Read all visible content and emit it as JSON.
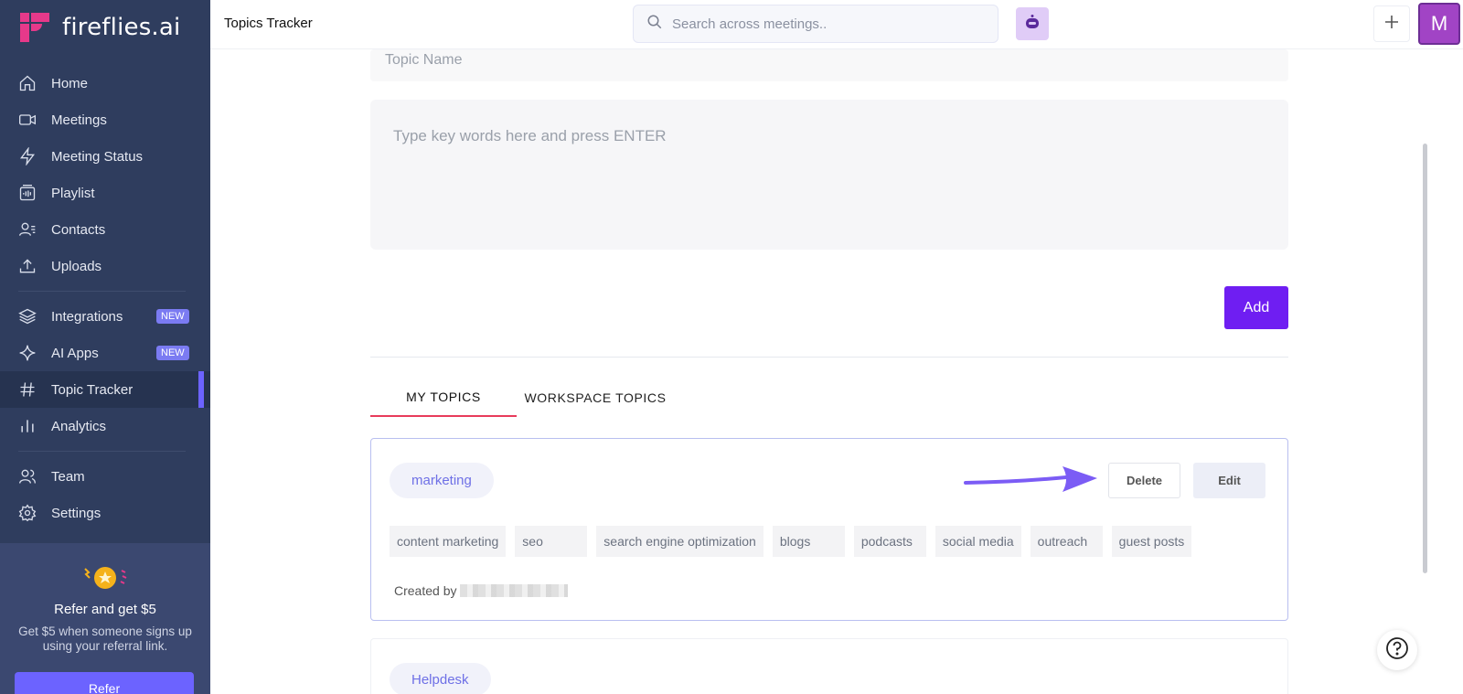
{
  "brand": {
    "name": "fireflies.ai"
  },
  "sidebar": {
    "items": [
      {
        "label": "Home",
        "icon": "home-icon"
      },
      {
        "label": "Meetings",
        "icon": "video-icon"
      },
      {
        "label": "Meeting Status",
        "icon": "bolt-icon"
      },
      {
        "label": "Playlist",
        "icon": "playlist-icon"
      },
      {
        "label": "Contacts",
        "icon": "contacts-icon"
      },
      {
        "label": "Uploads",
        "icon": "upload-icon"
      },
      {
        "label": "Integrations",
        "icon": "layers-icon",
        "badge": "NEW"
      },
      {
        "label": "AI Apps",
        "icon": "sparkle-icon",
        "badge": "NEW"
      },
      {
        "label": "Topic Tracker",
        "icon": "hash-icon",
        "active": true
      },
      {
        "label": "Analytics",
        "icon": "bar-chart-icon"
      },
      {
        "label": "Team",
        "icon": "team-icon"
      },
      {
        "label": "Settings",
        "icon": "gear-icon"
      }
    ],
    "refer": {
      "title": "Refer and get $5",
      "description": "Get $5 when someone signs up using your referral link.",
      "button": "Refer"
    }
  },
  "header": {
    "title": "Topics Tracker",
    "search_placeholder": "Search across meetings..",
    "avatar_initial": "M"
  },
  "form": {
    "topic_name_placeholder": "Topic Name",
    "keywords_placeholder": "Type key words here and press ENTER",
    "add_label": "Add"
  },
  "tabs": [
    {
      "label": "MY TOPICS",
      "active": true
    },
    {
      "label": "WORKSPACE TOPICS",
      "active": false
    }
  ],
  "topics": [
    {
      "name": "marketing",
      "delete_label": "Delete",
      "edit_label": "Edit",
      "keywords": [
        "content marketing",
        "seo",
        "search engine optimization",
        "blogs",
        "podcasts",
        "social media",
        "outreach",
        "guest posts"
      ],
      "created_by_label": "Created by"
    },
    {
      "name": "Helpdesk"
    }
  ],
  "colors": {
    "sidebar_bg": "#2f3d5e",
    "accent": "#6f1ef2",
    "active_tab_underline": "#e83b5b",
    "avatar_bg": "#a144c5"
  }
}
